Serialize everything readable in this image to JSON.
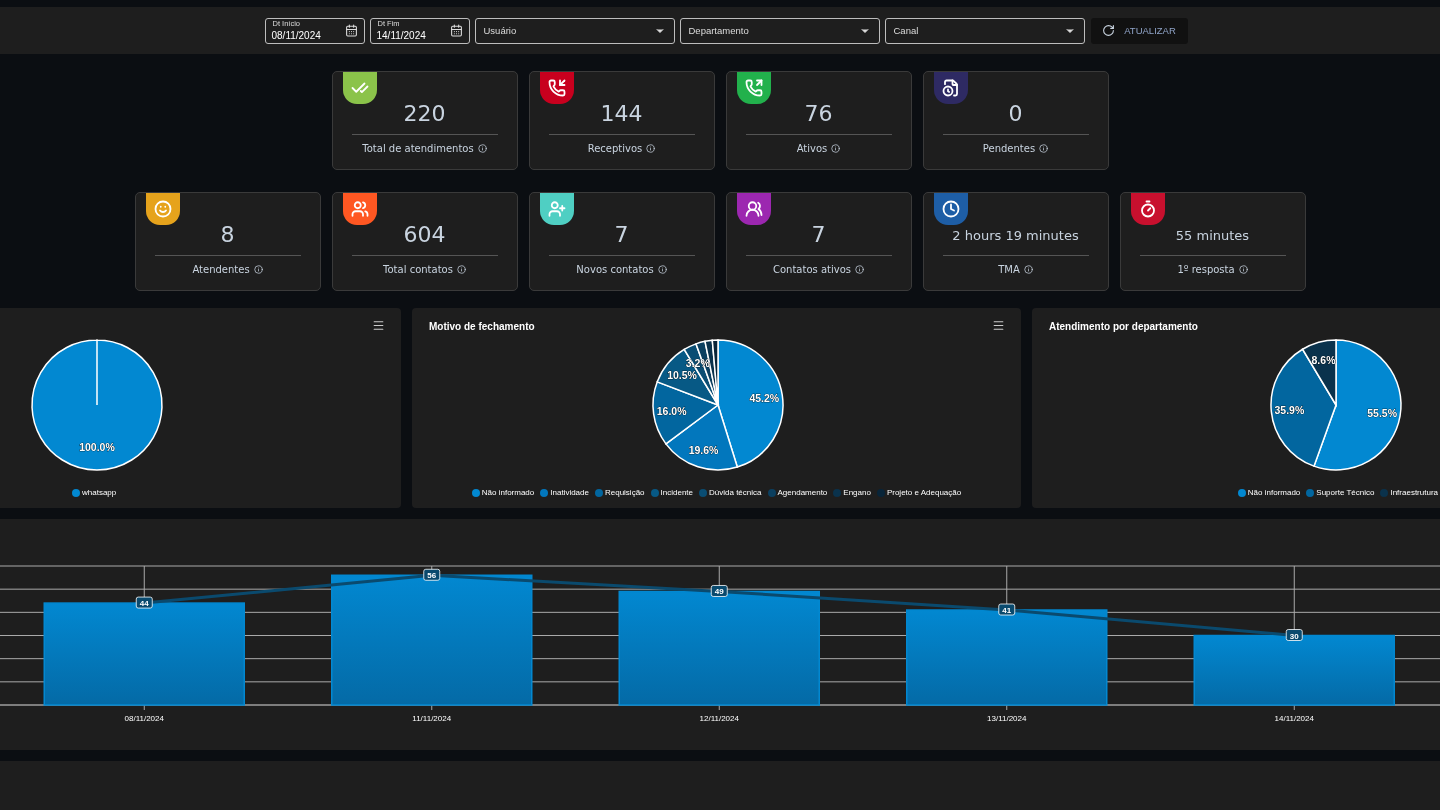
{
  "filters": {
    "date_fields": [
      {
        "label": "Dt Início",
        "value": "08/11/2024"
      },
      {
        "label": "Dt Fim",
        "value": "14/11/2024"
      }
    ],
    "selects": [
      {
        "placeholder": "Usuário"
      },
      {
        "placeholder": "Departamento"
      },
      {
        "placeholder": "Canal"
      }
    ],
    "refresh_button": "ATUALIZAR"
  },
  "stat_rows": [
    [
      {
        "value": "220",
        "label": "Total de atendimentos",
        "color": "#8bc34a"
      },
      {
        "value": "144",
        "label": "Receptivos",
        "color": "#c8001e"
      },
      {
        "value": "76",
        "label": "Ativos",
        "color": "#22b14c"
      },
      {
        "value": "0",
        "label": "Pendentes",
        "color": "#2e2a63"
      }
    ],
    [
      {
        "value": "8",
        "label": "Atendentes",
        "color": "#e6a31c"
      },
      {
        "value": "604",
        "label": "Total contatos",
        "color": "#ff5722"
      },
      {
        "value": "7",
        "label": "Novos contatos",
        "color": "#4fcfc3"
      },
      {
        "value": "7",
        "label": "Contatos ativos",
        "color": "#9c27b0"
      },
      {
        "value": "2 hours 19 minutes",
        "label": "TMA",
        "color": "#1e5ea6"
      },
      {
        "value": "55 minutes",
        "label": "1º resposta",
        "color": "#c8102e"
      }
    ]
  ],
  "pie_panels": [
    {
      "menu": true,
      "chart_data": {
        "type": "pie",
        "categories": [
          "whatsapp"
        ],
        "value_labels": [
          "100.0%"
        ],
        "series": [
          {
            "values": [
              100.0
            ]
          }
        ],
        "colors": [
          "#0288d1"
        ]
      }
    },
    {
      "title": "Motivo de fechamento",
      "menu": true,
      "chart_data": {
        "type": "pie",
        "categories": [
          "Não informado",
          "Inatividade",
          "Requisição",
          "Incidente",
          "Dúvida técnica",
          "Agendamento",
          "Engano",
          "Projeto e Adequação"
        ],
        "value_labels": [
          "45.2%",
          "19.6%",
          "16.0%",
          "10.5%",
          "3.2%",
          null,
          null,
          null
        ],
        "series": [
          {
            "values": [
              45.2,
              19.6,
              16.0,
              10.5,
              3.2,
              2.3,
              1.8,
              1.4
            ]
          }
        ],
        "colors": [
          "#0288d1",
          "#0277bd",
          "#02669f",
          "#075985",
          "#0a4d73",
          "#0b3f5f",
          "#0a324c",
          "#082438"
        ]
      }
    },
    {
      "title": "Atendimento por departamento",
      "menu": false,
      "chart_data": {
        "type": "pie",
        "categories": [
          "Não informado",
          "Suporte Técnico",
          "Infraestrutura"
        ],
        "value_labels": [
          "55.5%",
          "35.9%",
          "8.6%"
        ],
        "series": [
          {
            "values": [
              55.5,
              35.9,
              8.6
            ]
          }
        ],
        "colors": [
          "#0288d1",
          "#02669f",
          "#0a324c"
        ]
      }
    }
  ],
  "daily_chart": {
    "chart_data": {
      "type": "bar",
      "categories": [
        "08/11/2024",
        "11/11/2024",
        "12/11/2024",
        "13/11/2024",
        "14/11/2024"
      ],
      "grid": true,
      "series": [
        {
          "type": "bar",
          "color": "#0288d1",
          "values": [
            44,
            56,
            49,
            41,
            30
          ]
        },
        {
          "type": "line",
          "color": "#0a4a6e",
          "marker": true,
          "values": [
            44,
            56,
            49,
            41,
            30
          ],
          "value_labels": [
            "44",
            "56",
            "49",
            "41",
            "30"
          ]
        }
      ]
    }
  }
}
